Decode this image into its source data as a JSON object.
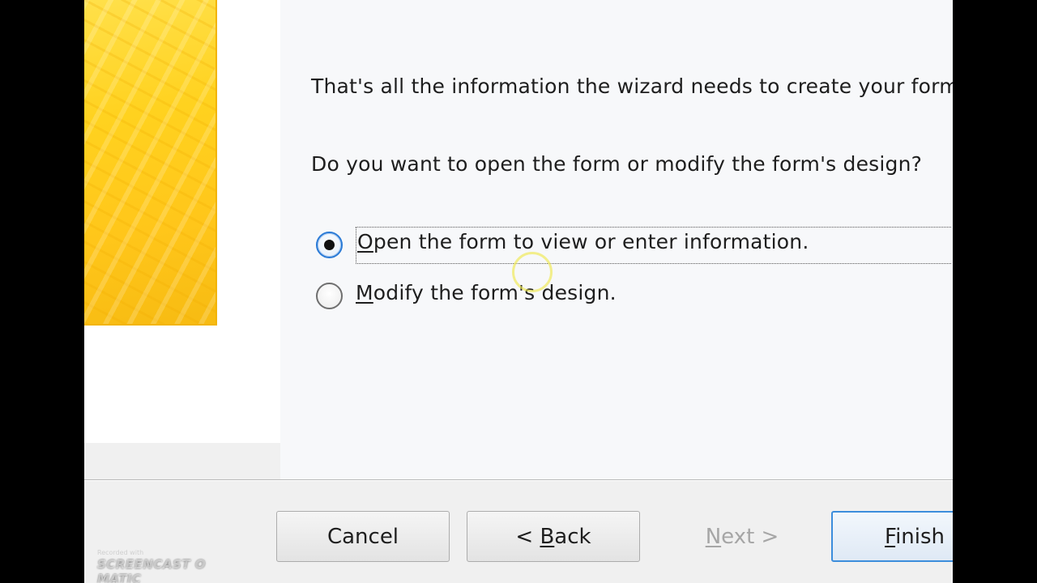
{
  "wizard": {
    "summary_text": "That's all the information the wizard needs to create your form.",
    "question_text": "Do you want to open the form or modify the form's design?",
    "options": [
      {
        "mnemonic": "O",
        "rest": "pen the form to view or enter information.",
        "selected": true
      },
      {
        "mnemonic": "M",
        "rest": "odify the form's design.",
        "selected": false
      }
    ]
  },
  "buttons": {
    "cancel_label": "Cancel",
    "back_prefix": "< ",
    "back_mnemonic": "B",
    "back_rest": "ack",
    "next_mnemonic": "N",
    "next_rest": "ext >",
    "finish_mnemonic": "F",
    "finish_rest": "inish"
  },
  "watermark": {
    "small_text": "Recorded with",
    "brand_text": "SCREENCAST O MATIC"
  },
  "colors": {
    "accent_blue": "#2a7ad6",
    "side_art_yellow": "#ffd21f",
    "disabled_text": "#a6a6a6"
  }
}
